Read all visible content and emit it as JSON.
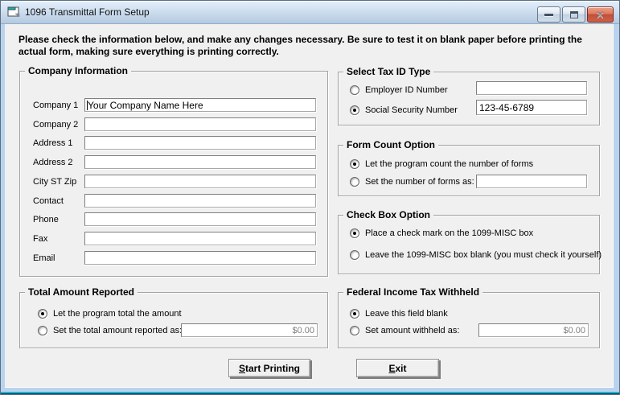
{
  "window": {
    "title": "1096 Transmittal Form Setup",
    "controls": {
      "minimize": "minimize",
      "maximize": "maximize",
      "close": "close"
    }
  },
  "instructions": "Please check the information below, and make any changes necessary. Be sure to test it on blank paper before printing the actual form, making sure everything is printing correctly.",
  "company_information": {
    "title": "Company Information",
    "fields": [
      {
        "label": "Company 1",
        "value": "Your Company Name Here"
      },
      {
        "label": "Company 2",
        "value": ""
      },
      {
        "label": "Address 1",
        "value": ""
      },
      {
        "label": "Address 2",
        "value": ""
      },
      {
        "label": "City ST Zip",
        "value": ""
      },
      {
        "label": "Contact",
        "value": ""
      },
      {
        "label": "Phone",
        "value": ""
      },
      {
        "label": "Fax",
        "value": ""
      },
      {
        "label": "Email",
        "value": ""
      }
    ]
  },
  "tax_id": {
    "title": "Select Tax ID Type",
    "options": [
      {
        "label": "Employer ID Number",
        "selected": false,
        "value": ""
      },
      {
        "label": "Social Security Number",
        "selected": true,
        "value": "123-45-6789"
      }
    ]
  },
  "form_count": {
    "title": "Form Count Option",
    "options": [
      {
        "label": "Let the program count the number of forms",
        "selected": true
      },
      {
        "label": "Set the number of forms as:",
        "selected": false,
        "value": ""
      }
    ]
  },
  "check_box": {
    "title": "Check Box Option",
    "options": [
      {
        "label": "Place a check mark on the 1099-MISC box",
        "selected": true
      },
      {
        "label": "Leave the 1099-MISC box blank (you must check it yourself)",
        "selected": false
      }
    ]
  },
  "total_amount": {
    "title": "Total Amount Reported",
    "options": [
      {
        "label": "Let the program total the amount",
        "selected": true
      },
      {
        "label": "Set the total amount reported as:",
        "selected": false,
        "value": "$0.00"
      }
    ]
  },
  "federal_tax": {
    "title": "Federal Income Tax Withheld",
    "options": [
      {
        "label": "Leave this field blank",
        "selected": true
      },
      {
        "label": "Set amount withheld as:",
        "selected": false,
        "value": "$0.00"
      }
    ]
  },
  "buttons": {
    "start_printing": "Start Printing",
    "exit": "Exit"
  },
  "colors": {
    "titlebar_top": "#e3eefa",
    "titlebar_bottom": "#b4c9e0",
    "window_border": "#b9d3ee",
    "bottom_edge_cyan": "#19b6d9",
    "client_bg": "#f0f0f0",
    "close_button_red": "#c14f38",
    "money_text": "#808080"
  }
}
